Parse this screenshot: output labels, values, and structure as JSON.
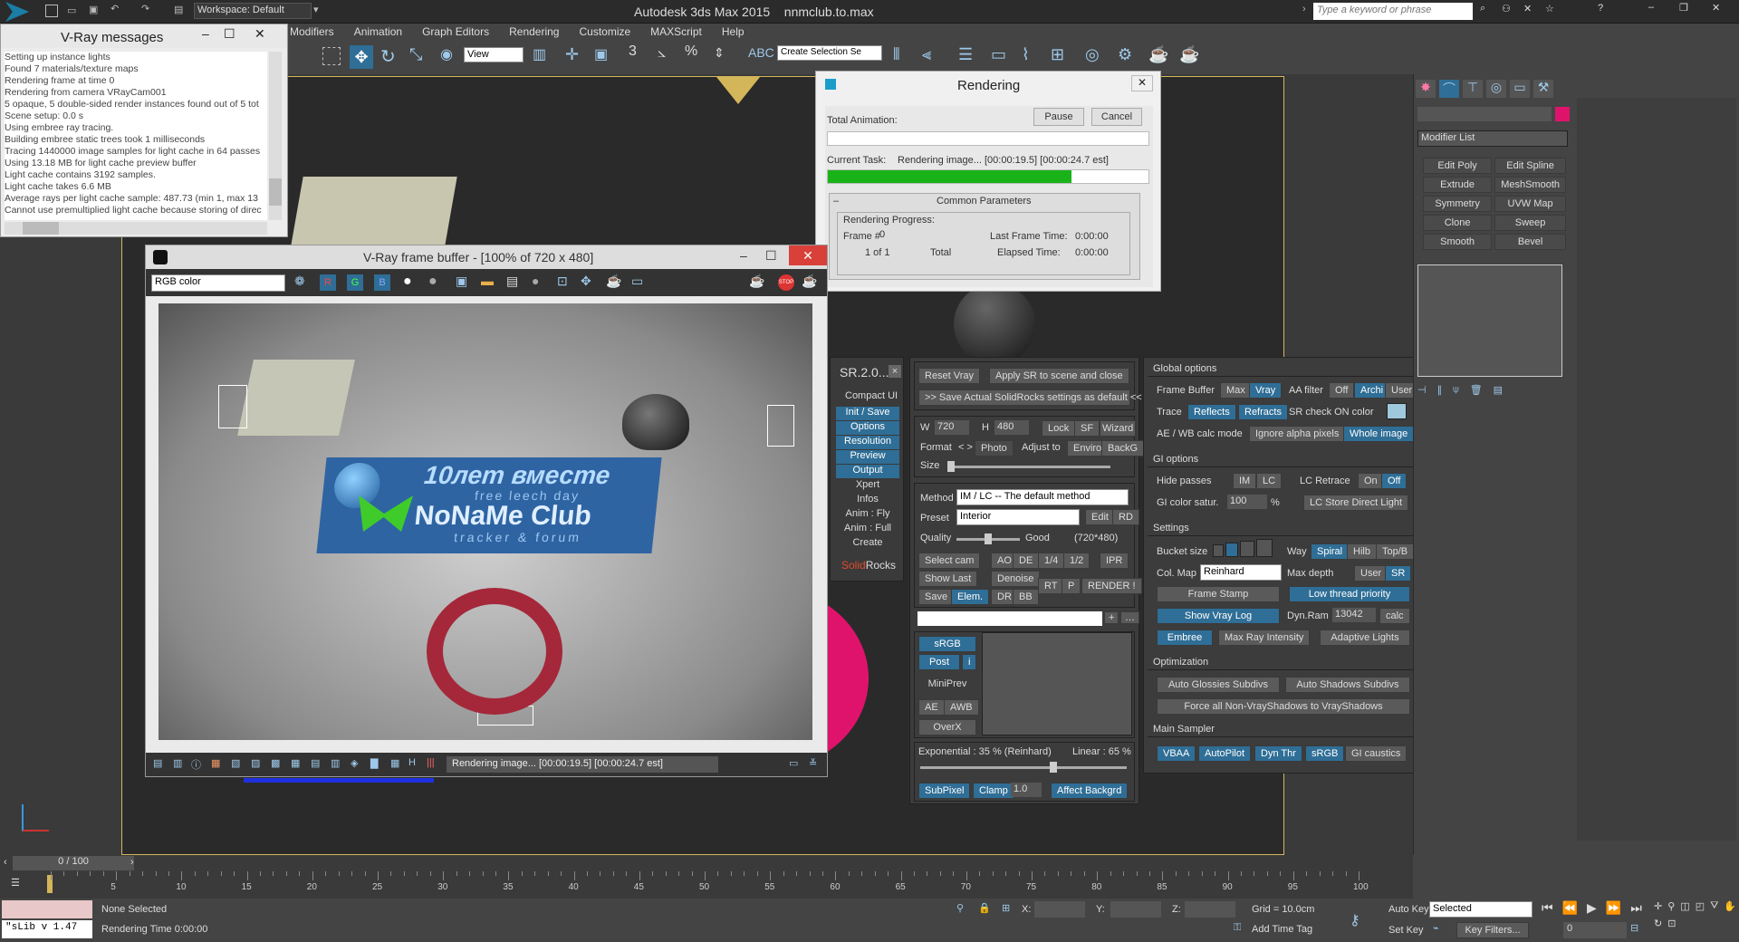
{
  "app": {
    "title": "Autodesk 3ds Max  2015",
    "file": "nnmclub.to.max",
    "workspace": "Workspace: Default",
    "search_placeholder": "Type a keyword or phrase"
  },
  "menu": [
    "Modifiers",
    "Animation",
    "Graph Editors",
    "Rendering",
    "Customize",
    "MAXScript",
    "Help"
  ],
  "toolbar": {
    "view_select": "View",
    "selection_set": "Create Selection Se"
  },
  "vray_messages": {
    "title": "V-Ray messages",
    "lines": [
      "Setting up instance lights",
      "Found 7 materials/texture maps",
      "Rendering frame at time 0",
      "Rendering from camera VRayCam001",
      "5 opaque, 5 double-sided render instances found out of 5 tot",
      "Scene setup: 0.0 s",
      "Using embree ray tracing.",
      "Building embree static trees took 1 milliseconds",
      "Tracing 1440000 image samples for light cache in 64 passes",
      "Using 13.18 MB for light cache preview buffer",
      "Light cache contains 3192 samples.",
      "Light cache takes 6.6 MB",
      "Average rays per light cache sample: 487.73 (min 1, max 13",
      "Cannot use premultiplied light cache because storing of direc"
    ]
  },
  "rendering_dialog": {
    "title": "Rendering",
    "total_animation": "Total Animation:",
    "pause": "Pause",
    "cancel": "Cancel",
    "current_task_label": "Current Task:",
    "current_task": "Rendering image... [00:00:19.5] [00:00:24.7 est]",
    "progress_total": 0,
    "progress_current": 0.76,
    "common_params": "Common Parameters",
    "rendering_progress": "Rendering Progress:",
    "frame_label": "Frame #",
    "frame_value": "0",
    "of_value": "1 of 1",
    "total_label": "Total",
    "last_frame_label": "Last Frame Time:",
    "last_frame_value": "0:00:00",
    "elapsed_label": "Elapsed Time:",
    "elapsed_value": "0:00:00"
  },
  "frame_buffer": {
    "title": "V-Ray frame buffer - [100% of 720 x 480]",
    "channel": "RGB color",
    "status": "Rendering image... [00:00:19.5] [00:00:24.7 est]",
    "banner_title": "10лет вместе",
    "banner_sub1": "free leech day",
    "banner_main": "NoNaMe Club",
    "banner_sub2": "tracker & forum"
  },
  "sr": {
    "version": "SR.2.0...",
    "left_menu": [
      "Compact UI",
      "Init / Save",
      "Options",
      "Resolution",
      "Preview",
      "Output",
      "Xpert",
      "Infos",
      "Anim : Fly",
      "Anim : Full",
      "Create"
    ],
    "logo_a": "Solid",
    "logo_b": "Rocks",
    "reset": "Reset Vray",
    "apply": "Apply SR to scene and close",
    "save_default": ">> Save Actual SolidRocks settings as default <<",
    "w_label": "W",
    "w_value": "720",
    "h_label": "H",
    "h_value": "480",
    "lock": "Lock",
    "sf": "SF",
    "wizard": "Wizard",
    "format": "Format",
    "photo": "Photo",
    "adjust": "Adjust to",
    "enviro": "Enviro",
    "backg": "BackG",
    "size": "Size",
    "method_label": "Method",
    "method_value": "IM / LC -- The default method",
    "preset_label": "Preset",
    "preset_value": "Interior",
    "edit": "Edit",
    "rd": "RD",
    "quality_label": "Quality",
    "quality_value": "Good",
    "quality_res": "(720*480)",
    "quality_pos": 0.5,
    "select_cam": "Select cam",
    "ao": "AO",
    "de": "DE",
    "q14": "1/4",
    "q12": "1/2",
    "ipr": "IPR",
    "show_last": "Show Last",
    "denoise": "Denoise",
    "rt": "RT",
    "p": "P",
    "render": "RENDER !",
    "save": "Save",
    "elem": "Elem.",
    "dr": "DR",
    "bb": "BB",
    "srgb": "sRGB",
    "post": "Post",
    "i": "i",
    "miniprev": "MiniPrev",
    "ae": "AE",
    "awb": "AWB",
    "overx": "OverX",
    "exposure": "Exponential : 35 %  (Reinhard)",
    "linear": "Linear : 65 %",
    "exposure_pos": 0.65,
    "subpixel": "SubPixel",
    "clamp": "Clamp",
    "clamp_value": "1.0",
    "affect": "Affect Backgrd"
  },
  "global_options": {
    "header": "Global options",
    "frame_buffer": "Frame Buffer",
    "max": "Max",
    "vray": "Vray",
    "aa_filter": "AA filter",
    "off": "Off",
    "archi": "Archi",
    "user": "User",
    "trace": "Trace",
    "reflects": "Reflects",
    "refracts": "Refracts",
    "sr_check": "SR check ON color",
    "ae_wb": "AE / WB calc mode",
    "ignore_alpha": "Ignore alpha pixels",
    "whole_image": "Whole image",
    "gi_header": "GI options",
    "hide_passes": "Hide passes",
    "im": "IM",
    "lc": "LC",
    "lc_retrace": "LC Retrace",
    "on": "On",
    "off2": "Off",
    "gi_color": "GI color satur.",
    "gi_value": "100",
    "percent": "%",
    "lc_store": "LC Store Direct Light",
    "settings_header": "Settings",
    "bucket": "Bucket size",
    "way": "Way",
    "spiral": "Spiral",
    "hilb": "Hilb",
    "topb": "Top/B",
    "colmap": "Col. Map",
    "colmap_value": "Reinhard",
    "maxdepth": "Max depth",
    "user2": "User",
    "sr": "SR",
    "frame_stamp": "Frame Stamp",
    "low_thread": "Low thread priority",
    "show_log": "Show Vray Log",
    "dynram": "Dyn.Ram",
    "dynram_value": "13042",
    "calc": "calc",
    "embree": "Embree",
    "maxray": "Max Ray Intensity",
    "adaptive": "Adaptive Lights",
    "opt_header": "Optimization",
    "auto_glossy": "Auto Glossies Subdivs",
    "auto_shadows": "Auto Shadows Subdivs",
    "force_shadows": "Force all Non-VrayShadows to VrayShadows",
    "sampler_header": "Main Sampler",
    "vbaa": "VBAA",
    "autopilot": "AutoPilot",
    "dynthr": "Dyn Thr",
    "srgb2": "sRGB",
    "gi_caustics": "GI caustics"
  },
  "command_panel": {
    "modifier_list": "Modifier List",
    "buttons": [
      "Edit Poly",
      "Edit Spline",
      "Extrude",
      "MeshSmooth",
      "Symmetry",
      "UVW Map",
      "Clone",
      "Sweep",
      "Smooth",
      "Bevel"
    ]
  },
  "timeline": {
    "frame": "0 / 100",
    "ticks": [
      "5",
      "10",
      "15",
      "20",
      "25",
      "30",
      "35",
      "40",
      "45",
      "50",
      "55",
      "60",
      "65",
      "70",
      "75",
      "80",
      "85",
      "90",
      "95",
      "100"
    ]
  },
  "status": {
    "script": "\"sLib v 1.47",
    "none_selected": "None Selected",
    "render_time": "Rendering Time  0:00:00",
    "x": "X:",
    "y": "Y:",
    "z": "Z:",
    "grid": "Grid = 10.0cm",
    "add_tag": "Add Time Tag",
    "auto_key": "Auto Key",
    "selected": "Selected",
    "set_key": "Set Key",
    "key_filters": "Key Filters...",
    "frame_field": "0"
  },
  "colors": {
    "accent": "#2f6e96",
    "progress": "#19b219",
    "viewport": "#2a2a2a",
    "frame": "#d4b65a"
  }
}
